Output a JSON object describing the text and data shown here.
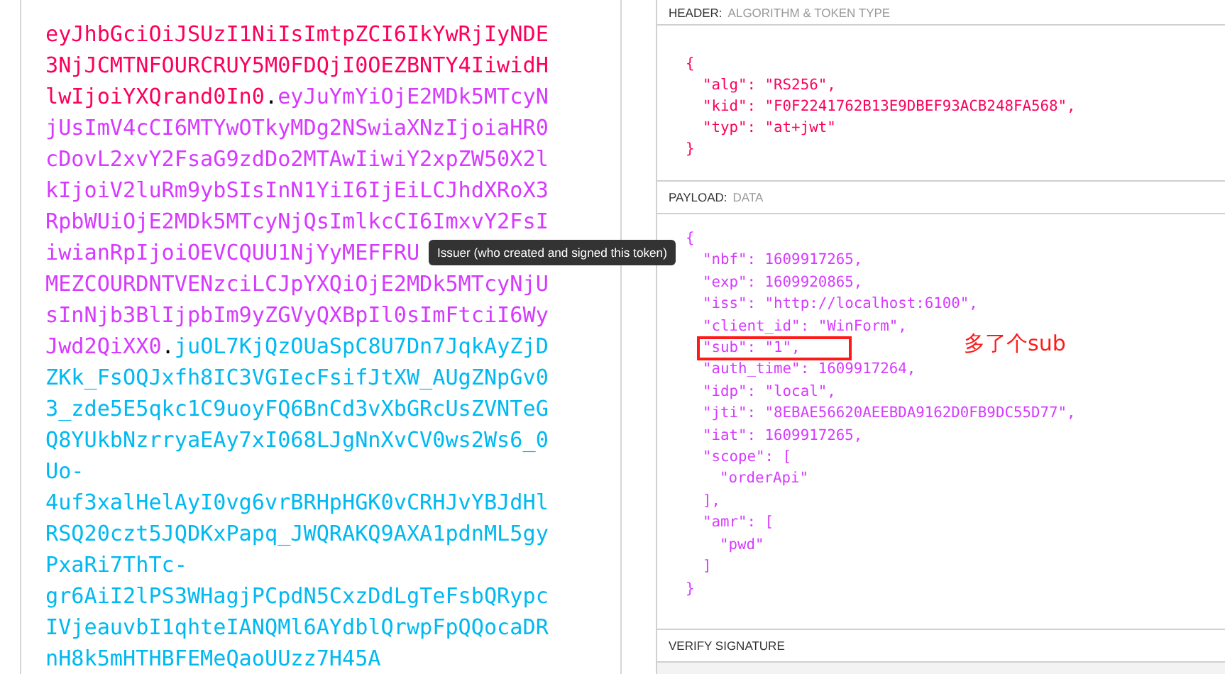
{
  "encoded_token": {
    "lines": [
      [
        {
          "kind": "header",
          "text": "eyJhbGciOiJSUzI1NiIsImtpZCI6IkYwRjIyNDE"
        }
      ],
      [
        {
          "kind": "header",
          "text": "3NjJCMTNFOURCRUY5M0FDQjI0OEZBNTY4IiwidH"
        }
      ],
      [
        {
          "kind": "header",
          "text": "lwIjoiYXQrand0In0"
        },
        {
          "kind": "dot",
          "text": "."
        },
        {
          "kind": "payload",
          "text": "eyJuYmYiOjE2MDk5MTcyN"
        }
      ],
      [
        {
          "kind": "payload",
          "text": "jUsImV4cCI6MTYwOTkyMDg2NSwiaXNzIjoiaHR0"
        }
      ],
      [
        {
          "kind": "payload",
          "text": "cDovL2xvY2FsaG9zdDo2MTAwIiwiY2xpZW50X2l"
        }
      ],
      [
        {
          "kind": "payload",
          "text": "kIjoiV2luRm9ybSIsInN1YiI6IjEiLCJhdXRoX3"
        }
      ],
      [
        {
          "kind": "payload",
          "text": "RpbWUiOjE2MDk5MTcyNjQsImlkcCI6ImxvY2FsI"
        }
      ],
      [
        {
          "kind": "payload",
          "text": "iwianRpIjoiOEVCQUU1NjYyMEFFRU"
        }
      ],
      [
        {
          "kind": "payload",
          "text": "MEZCOURDNTVENzciLCJpYXQiOjE2MDk5MTcyNjU"
        }
      ],
      [
        {
          "kind": "payload",
          "text": "sInNjb3BlIjpbIm9yZGVyQXBpIl0sImFtciI6Wy"
        }
      ],
      [
        {
          "kind": "payload",
          "text": "Jwd2QiXX0"
        },
        {
          "kind": "dot",
          "text": "."
        },
        {
          "kind": "signature",
          "text": "juOL7KjQzOUaSpC8U7Dn7JqkAyZjD"
        }
      ],
      [
        {
          "kind": "signature",
          "text": "ZKk_FsOQJxfh8IC3VGIecFsifJtXW_AUgZNpGv0"
        }
      ],
      [
        {
          "kind": "signature",
          "text": "3_zde5E5qkc1C9uoyFQ6BnCd3vXbGRcUsZVNTeG"
        }
      ],
      [
        {
          "kind": "signature",
          "text": "Q8YUkbNzrryaEAy7xI068LJgNnXvCV0ws2Ws6_0"
        }
      ],
      [
        {
          "kind": "signature",
          "text": "Uo-"
        }
      ],
      [
        {
          "kind": "signature",
          "text": "4uf3xalHelAyI0vg6vrBRHpHGK0vCRHJvYBJdHl"
        }
      ],
      [
        {
          "kind": "signature",
          "text": "RSQ20czt5JQDKxPapq_JWQRAKQ9AXA1pdnML5gy"
        }
      ],
      [
        {
          "kind": "signature",
          "text": "PxaRi7ThTc-"
        }
      ],
      [
        {
          "kind": "signature",
          "text": "gr6AiI2lPS3WHagjPCpdN5CxzDdLgTeFsbQRypc"
        }
      ],
      [
        {
          "kind": "signature",
          "text": "IVjeauvbI1qhteIANQMl6AYdblQrwpFpQQocaDR"
        }
      ],
      [
        {
          "kind": "signature",
          "text": "nH8k5mHTHBFEMeQaoUUzz7H45A"
        }
      ]
    ]
  },
  "tooltip": "Issuer (who created and signed this token)",
  "header": {
    "label": "HEADER:",
    "sublabel": "ALGORITHM & TOKEN TYPE",
    "open": "{",
    "lines": [
      {
        "text": "\"alg\": \"RS256\","
      },
      {
        "text": "\"kid\": \"F0F2241762B13E9DBEF93ACB248FA568\","
      },
      {
        "text": "\"typ\": \"at+jwt\""
      }
    ],
    "close": "}"
  },
  "payload": {
    "label": "PAYLOAD:",
    "sublabel": "DATA",
    "open": "{",
    "lines": [
      {
        "text": "\"nbf\": 1609917265,",
        "highlighted": false
      },
      {
        "text": "\"exp\": 1609920865,",
        "highlighted": false
      },
      {
        "text": "\"iss\": \"http://localhost:6100\",",
        "highlighted": false
      },
      {
        "text": "\"client_id\": \"WinForm\",",
        "highlighted": false
      },
      {
        "text": "\"sub\": \"1\",",
        "highlighted": true
      },
      {
        "text": "\"auth_time\": 1609917264,",
        "highlighted": false
      },
      {
        "text": "\"idp\": \"local\",",
        "highlighted": false
      },
      {
        "text": "\"jti\": \"8EBAE56620AEEBDA9162D0FB9DC55D77\",",
        "highlighted": false
      },
      {
        "text": "\"iat\": 1609917265,",
        "highlighted": false
      },
      {
        "text": "\"scope\": [",
        "highlighted": false,
        "children": [
          {
            "text": "\"orderApi\""
          }
        ],
        "close": "],"
      },
      {
        "text": "\"amr\": [",
        "highlighted": false,
        "children": [
          {
            "text": "\"pwd\""
          }
        ],
        "close": "]"
      }
    ],
    "close": "}"
  },
  "annotation": "多了个sub",
  "verify": {
    "label": "VERIFY SIGNATURE"
  }
}
